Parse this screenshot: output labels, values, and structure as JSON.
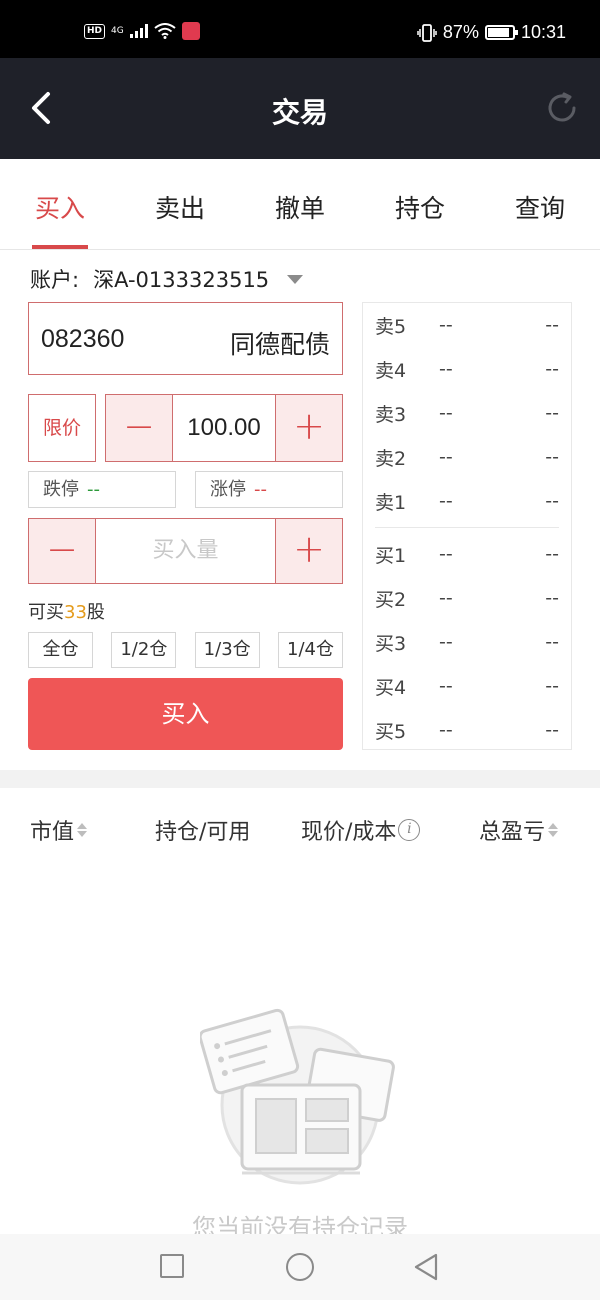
{
  "status_bar": {
    "network": "4G",
    "battery": "87%",
    "battery_level": 0.87,
    "time": "10:31"
  },
  "nav": {
    "title": "交易"
  },
  "tabs": [
    {
      "label": "买入",
      "active": true
    },
    {
      "label": "卖出",
      "active": false
    },
    {
      "label": "撤单",
      "active": false
    },
    {
      "label": "持仓",
      "active": false
    },
    {
      "label": "查询",
      "active": false
    }
  ],
  "account": {
    "label": "账户:",
    "value": "深A-0133323515"
  },
  "stock": {
    "code": "082360",
    "name": "同德配债"
  },
  "price": {
    "type": "限价",
    "minus": "−",
    "value": "100.00",
    "plus": "+"
  },
  "limits": {
    "down_label": "跌停",
    "down_value": "--",
    "up_label": "涨停",
    "up_value": "--"
  },
  "quantity": {
    "placeholder": "买入量",
    "minus": "−",
    "plus": "+"
  },
  "can_buy": {
    "prefix": "可买",
    "count": "33",
    "suffix": "股"
  },
  "position_buttons": [
    "全仓",
    "1/2仓",
    "1/3仓",
    "1/4仓"
  ],
  "buy_button": "买入",
  "orderbook": {
    "asks": [
      {
        "label": "卖5",
        "price": "--",
        "volume": "--"
      },
      {
        "label": "卖4",
        "price": "--",
        "volume": "--"
      },
      {
        "label": "卖3",
        "price": "--",
        "volume": "--"
      },
      {
        "label": "卖2",
        "price": "--",
        "volume": "--"
      },
      {
        "label": "卖1",
        "price": "--",
        "volume": "--"
      }
    ],
    "bids": [
      {
        "label": "买1",
        "price": "--",
        "volume": "--"
      },
      {
        "label": "买2",
        "price": "--",
        "volume": "--"
      },
      {
        "label": "买3",
        "price": "--",
        "volume": "--"
      },
      {
        "label": "买4",
        "price": "--",
        "volume": "--"
      },
      {
        "label": "买5",
        "price": "--",
        "volume": "--"
      }
    ]
  },
  "positions": {
    "headers": {
      "market_value": "市值",
      "holding": "持仓/可用",
      "price_cost": "现价/成本",
      "total_pnl": "总盈亏"
    },
    "empty_text": "您当前没有持仓记录"
  },
  "colors": {
    "accent": "#d8494a",
    "buy_button": "#ef5656",
    "nav_bg": "#1f2129",
    "limit_down": "#2c9a3a",
    "can_buy_count": "#e49b1c"
  }
}
